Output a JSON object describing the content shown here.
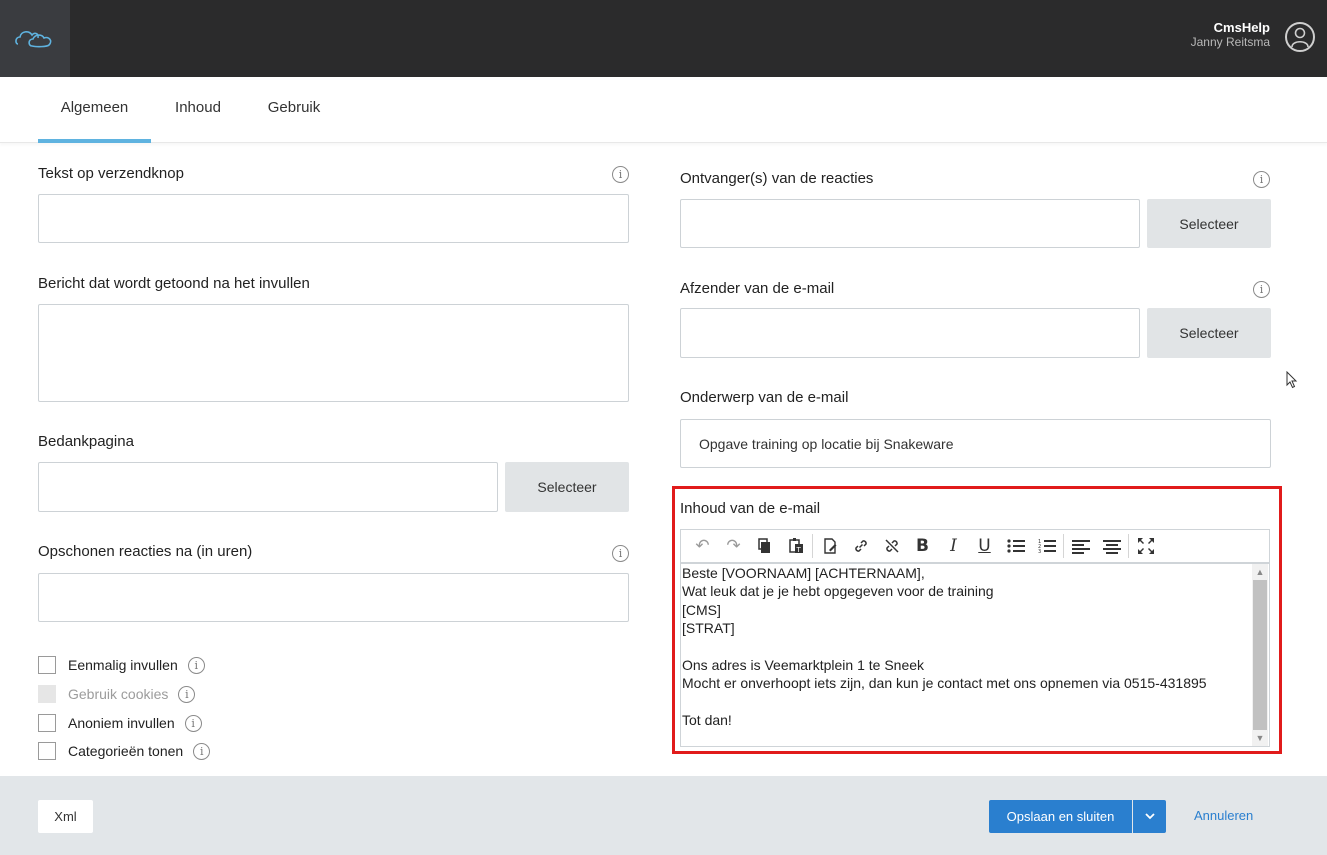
{
  "header": {
    "app_name": "CmsHelp",
    "user_name": "Janny Reitsma"
  },
  "tabs": [
    {
      "label": "Algemeen",
      "active": true
    },
    {
      "label": "Inhoud",
      "active": false
    },
    {
      "label": "Gebruik",
      "active": false
    }
  ],
  "left": {
    "submit_text": {
      "label": "Tekst op verzendknop",
      "value": ""
    },
    "message_after": {
      "label": "Bericht dat wordt getoond na het invullen",
      "value": ""
    },
    "thanks_page": {
      "label": "Bedankpagina",
      "value": "",
      "button": "Selecteer"
    },
    "cleanup": {
      "label": "Opschonen reacties na (in uren)",
      "value": ""
    },
    "checkboxes": [
      {
        "label": "Eenmalig invullen",
        "checked": false,
        "disabled": false
      },
      {
        "label": "Gebruik cookies",
        "checked": false,
        "disabled": true
      },
      {
        "label": "Anoniem invullen",
        "checked": false,
        "disabled": false
      },
      {
        "label": "Categorieën tonen",
        "checked": false,
        "disabled": false
      }
    ]
  },
  "right": {
    "recipients": {
      "label": "Ontvanger(s) van de reacties",
      "value": "",
      "button": "Selecteer"
    },
    "sender": {
      "label": "Afzender van de e-mail",
      "value": "",
      "button": "Selecteer"
    },
    "subject": {
      "label": "Onderwerp van de e-mail",
      "value": "Opgave training op locatie bij Snakeware"
    },
    "content": {
      "label": "Inhoud van de e-mail",
      "lines": [
        "Beste [VOORNAAM] [ACHTERNAAM],",
        "Wat leuk dat je je hebt opgegeven voor de training",
        "[CMS]",
        "[STRAT]",
        "",
        "Ons adres is Veemarktplein 1 te Sneek",
        "Mocht er onverhoopt iets zijn, dan kun je contact met ons opnemen via 0515-431895",
        "",
        "Tot dan!"
      ]
    }
  },
  "footer": {
    "xml_label": "Xml",
    "save_label": "Opslaan en sluiten",
    "cancel_label": "Annuleren"
  },
  "colors": {
    "primary": "#2a7fcf",
    "tab_active": "#5fb3e0",
    "highlight": "#e11b1b",
    "topbar": "#2b2b2c"
  }
}
